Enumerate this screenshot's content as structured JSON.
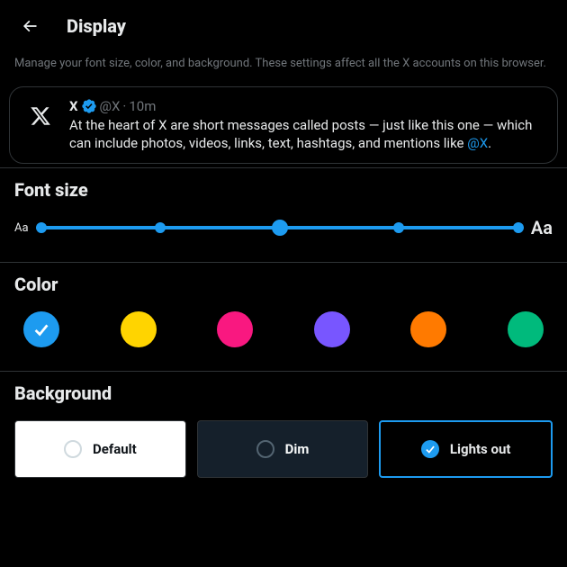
{
  "header": {
    "title": "Display"
  },
  "description": "Manage your font size, color, and background. These settings affect all the X accounts on this browser.",
  "tweet": {
    "name": "X",
    "handle": "@X",
    "time": "10m",
    "body_pre": "At the heart of X are short messages called posts — just like this one — which can include photos, videos, links, text, hashtags, and mentions like ",
    "mention": "@X",
    "body_post": "."
  },
  "font_size": {
    "title": "Font size",
    "label_small": "Aa",
    "label_big": "Aa",
    "steps": 5,
    "selected_index": 2
  },
  "color": {
    "title": "Color",
    "options": [
      {
        "hex": "#1d9bf0",
        "selected": true
      },
      {
        "hex": "#ffd400",
        "selected": false
      },
      {
        "hex": "#f91880",
        "selected": false
      },
      {
        "hex": "#7856ff",
        "selected": false
      },
      {
        "hex": "#ff7a00",
        "selected": false
      },
      {
        "hex": "#00ba7c",
        "selected": false
      }
    ]
  },
  "background": {
    "title": "Background",
    "options": [
      {
        "key": "default",
        "label": "Default",
        "selected": false
      },
      {
        "key": "dim",
        "label": "Dim",
        "selected": false
      },
      {
        "key": "lightsout",
        "label": "Lights out",
        "selected": true
      }
    ]
  }
}
